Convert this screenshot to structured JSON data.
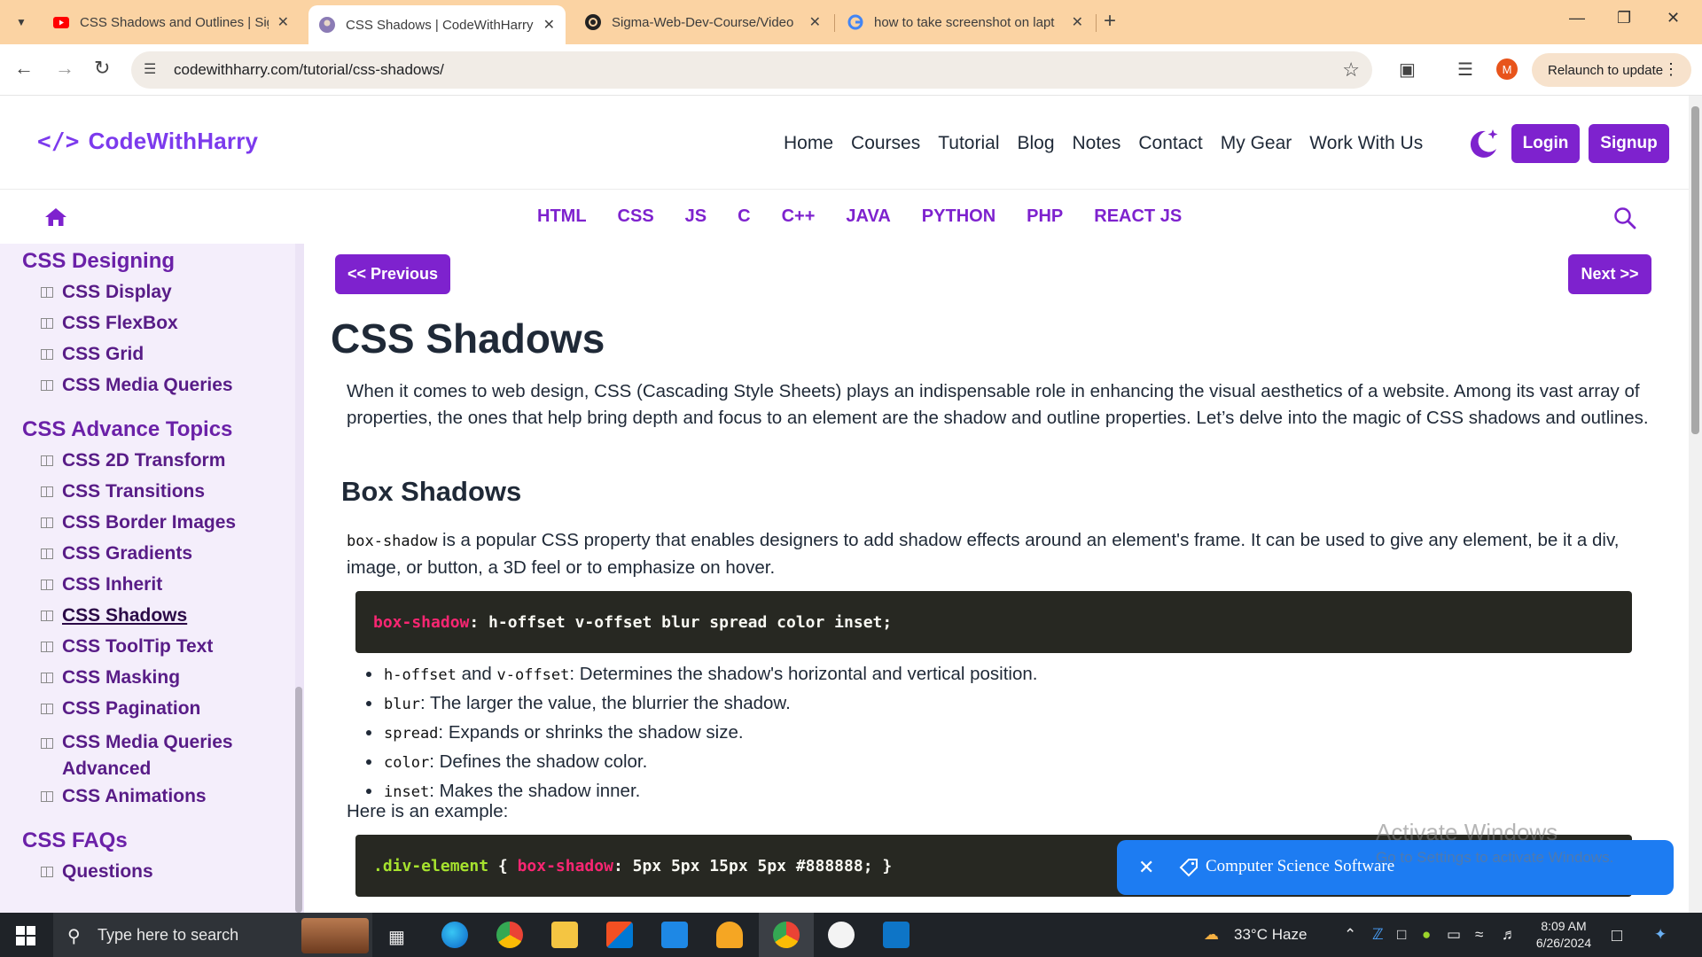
{
  "browser": {
    "tabs": [
      {
        "title": "CSS Shadows and Outlines | Sig",
        "favicon": "youtube-icon",
        "active": false
      },
      {
        "title": "CSS Shadows | CodeWithHarry",
        "favicon": "codewithharry-icon",
        "active": true
      },
      {
        "title": "Sigma-Web-Dev-Course/Video",
        "favicon": "github-icon",
        "active": false
      },
      {
        "title": "how to take screenshot on lapt",
        "favicon": "google-icon",
        "active": false
      }
    ],
    "url": "codewithharry.com/tutorial/css-shadows/",
    "profile_initial": "M",
    "relaunch_label": "Relaunch to update"
  },
  "site": {
    "logo_text": "CodeWithHarry",
    "logo_symbol": "</>",
    "nav": [
      "Home",
      "Courses",
      "Tutorial",
      "Blog",
      "Notes",
      "Contact",
      "My Gear",
      "Work With Us"
    ],
    "login_label": "Login",
    "signup_label": "Signup",
    "languages": [
      "HTML",
      "CSS",
      "JS",
      "C",
      "C++",
      "JAVA",
      "PYTHON",
      "PHP",
      "REACT JS"
    ],
    "accent_color": "#7e22ce"
  },
  "sidebar": {
    "sections": [
      {
        "title": "CSS Designing",
        "items": [
          "CSS Display",
          "CSS FlexBox",
          "CSS Grid",
          "CSS Media Queries"
        ]
      },
      {
        "title": "CSS Advance Topics",
        "items": [
          "CSS 2D Transform",
          "CSS Transitions",
          "CSS Border Images",
          "CSS Gradients",
          "CSS Inherit",
          "CSS Shadows",
          "CSS ToolTip Text",
          "CSS Masking",
          "CSS Pagination",
          "CSS Media Queries Advanced",
          "CSS Animations"
        ]
      },
      {
        "title": "CSS FAQs",
        "items": [
          "Questions"
        ]
      }
    ],
    "current_item": "CSS Shadows"
  },
  "content": {
    "prev_label": "<< Previous",
    "next_label": "Next >>",
    "title": "CSS Shadows",
    "intro": "When it comes to web design, CSS (Cascading Style Sheets) plays an indispensable role in enhancing the visual aesthetics of a website. Among its vast array of properties, the ones that help bring depth and focus to an element are the shadow and outline properties. Let’s delve into the magic of CSS shadows and outlines.",
    "h2": "Box Shadows",
    "box_shadow_code": "box-shadow",
    "box_shadow_desc": " is a popular CSS property that enables designers to add shadow effects around an element's frame. It can be used to give any element, be it a div, image, or button, a 3D feel or to emphasize on hover.",
    "syntax": {
      "prop": "box-shadow",
      "rest": ": h-offset v-offset blur spread color inset;"
    },
    "bullets": [
      {
        "parts": [
          {
            "code": "h-offset"
          },
          {
            "text": " and "
          },
          {
            "code": "v-offset"
          },
          {
            "text": ": Determines the shadow's horizontal and vertical position."
          }
        ]
      },
      {
        "parts": [
          {
            "code": "blur"
          },
          {
            "text": ": The larger the value, the blurrier the shadow."
          }
        ]
      },
      {
        "parts": [
          {
            "code": "spread"
          },
          {
            "text": ": Expands or shrinks the shadow size."
          }
        ]
      },
      {
        "parts": [
          {
            "code": "color"
          },
          {
            "text": ": Defines the shadow color."
          }
        ]
      },
      {
        "parts": [
          {
            "code": "inset"
          },
          {
            "text": ": Makes the shadow inner."
          }
        ]
      }
    ],
    "example_label": "Here is an example:",
    "example": {
      "selector": ".div-element",
      "open": " { ",
      "prop": "box-shadow",
      "rest": ": 5px 5px 15px 5px #888888; }"
    }
  },
  "toast": {
    "text": "Computer Science Software"
  },
  "watermark": {
    "line1": "Activate Windows",
    "line2": "Go to Settings to activate Windows."
  },
  "taskbar": {
    "search_placeholder": "Type here to search",
    "weather": "33°C  Haze",
    "time": "8:09 AM",
    "date": "6/26/2024"
  }
}
